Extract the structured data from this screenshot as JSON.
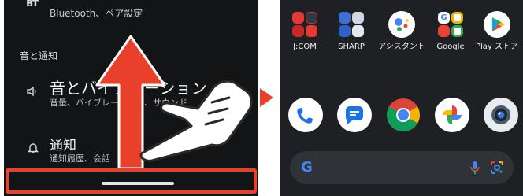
{
  "settings": {
    "bluetooth_glyph": "ʙᴛ",
    "bluetooth_subtitle": "Bluetooth、ペア設定",
    "section_sound": "音と通知",
    "sound_title": "音とバイブレーション",
    "sound_subtitle": "音量、バイブレーション、サウンド",
    "notif_title": "通知",
    "notif_subtitle": "通知履歴、会話"
  },
  "home": {
    "apps": [
      {
        "label": "J:COM"
      },
      {
        "label": "SHARP"
      },
      {
        "label": "アシスタント"
      },
      {
        "label": "Google"
      },
      {
        "label": "Play ストア"
      }
    ],
    "dock": [
      "phone-icon",
      "messages-icon",
      "chrome-icon",
      "photos-icon",
      "camera-icon"
    ],
    "search": {
      "logo": "G"
    }
  },
  "colors": {
    "accent_red": "#e8402b",
    "left_bg": "#131416",
    "right_bg": "#1e2023"
  }
}
